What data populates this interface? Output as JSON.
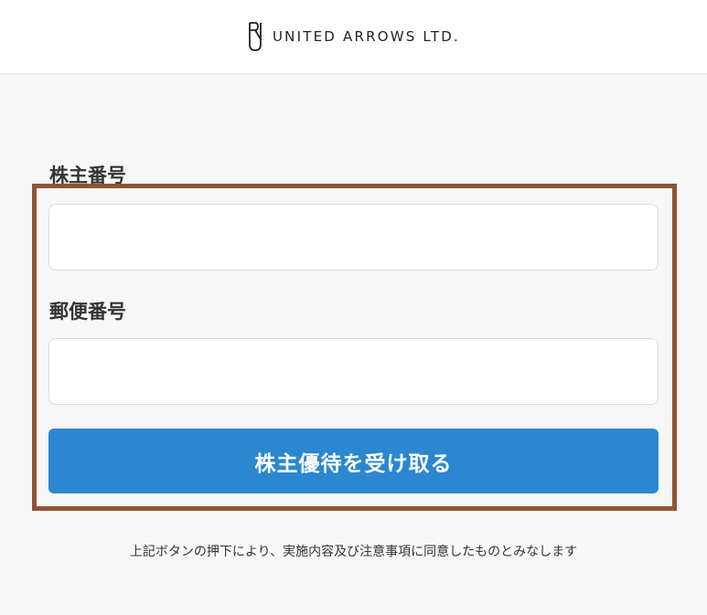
{
  "header": {
    "logo_text": "UNITED ARROWS LTD.",
    "logo_icon": "united-arrows-logo-mark"
  },
  "form": {
    "shareholder_number_label": "株主番号",
    "shareholder_number_value": "",
    "shareholder_number_placeholder": "",
    "postal_code_label": "郵便番号",
    "postal_code_value": "",
    "postal_code_placeholder": "",
    "submit_label": "株主優待を受け取る",
    "notice": "上記ボタンの押下により、実施内容及び注意事項に同意したものとみなします"
  },
  "colors": {
    "button": "#2a87d0",
    "highlight_border": "#8e5535",
    "background": "#f7f7f7"
  }
}
